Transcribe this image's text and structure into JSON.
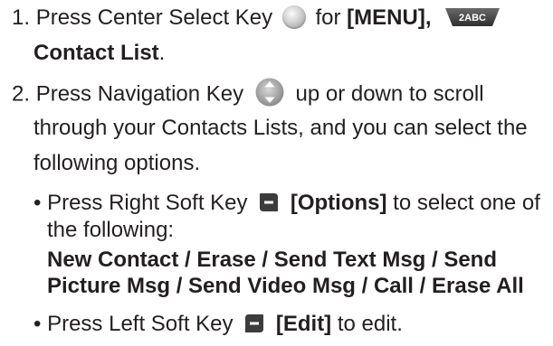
{
  "step1": {
    "number": "1.",
    "text_a": "Press Center Select Key",
    "text_b": "for",
    "menu": "[MENU],",
    "key_label": "2ABC",
    "dest": "Contact List",
    "dest_end": "."
  },
  "step2": {
    "number": "2.",
    "text_a": "Press Navigation Key",
    "text_b": "up or down to scroll",
    "line2": "through your Contacts Lists, and you can select the",
    "line3": "following options."
  },
  "bullet1": {
    "bullet": "•",
    "text_a": "Press Right Soft Key",
    "options": "[Options]",
    "text_b": "to select one of",
    "line2": "the following:",
    "list_line1": "New Contact / Erase / Send Text Msg / Send",
    "list_line2": "Picture Msg / Send Video Msg / Call / Erase All"
  },
  "bullet2": {
    "bullet": "•",
    "text_a": "Press Left Soft Key",
    "edit": "[Edit]",
    "text_b": "to edit."
  },
  "icons": {
    "center_select": "center-select-key-icon",
    "number_key": "two-abc-key-icon",
    "navigation": "navigation-key-icon",
    "right_soft": "right-soft-key-icon",
    "left_soft": "left-soft-key-icon"
  },
  "colors": {
    "text": "#231f20",
    "key_dark": "#3c3c3c",
    "nav_gray": "#9a9a9a"
  }
}
